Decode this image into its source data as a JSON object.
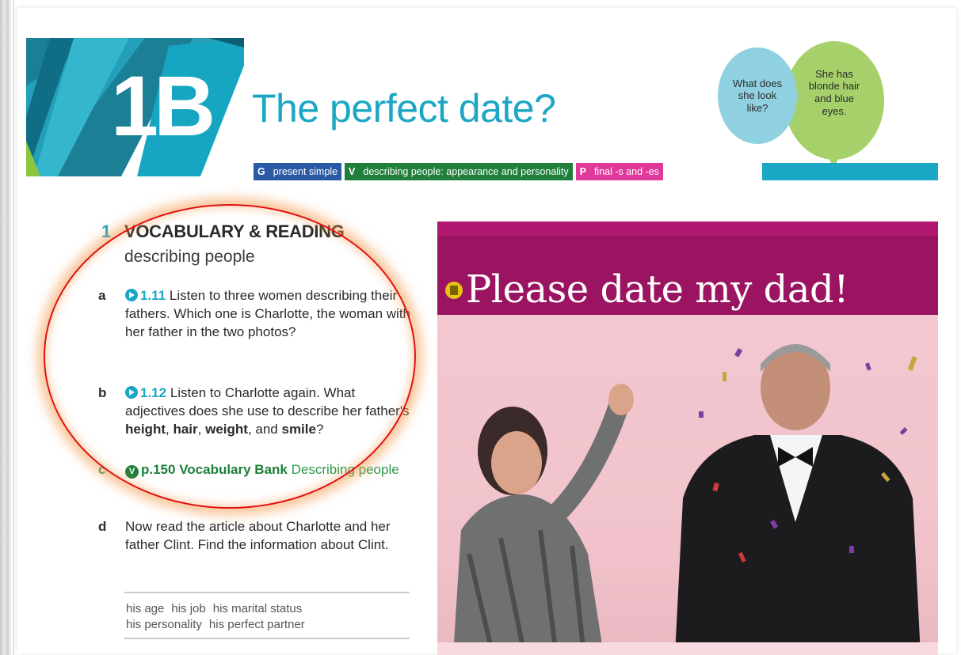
{
  "header": {
    "lesson_code": "1B",
    "lesson_title": "The perfect date?",
    "bubbles": {
      "question": "What does she look like?",
      "answer": "She has blonde hair and blue eyes."
    },
    "tags": [
      {
        "key": "G",
        "label": "present simple"
      },
      {
        "key": "V",
        "label": "describing people: appearance and personality"
      },
      {
        "key": "P",
        "label": "final -s and -es"
      }
    ]
  },
  "section": {
    "number": "1",
    "title": "VOCABULARY & READING",
    "subtitle": "describing people"
  },
  "exercises": {
    "a": {
      "letter": "a",
      "ref": "1.11",
      "text": "Listen to three women describing their fathers. Which one is Charlotte, the woman with her father in the two photos?"
    },
    "b": {
      "letter": "b",
      "ref": "1.12",
      "text_start": "Listen to Charlotte again. What adjectives does she use to describe her father's ",
      "w1": "height",
      "sep1": ", ",
      "w2": "hair",
      "sep2": ", ",
      "w3": "weight",
      "sep3": ", and ",
      "w4": "smile",
      "end": "?"
    },
    "c": {
      "letter": "c",
      "icon": "V",
      "bank": "p.150 Vocabulary Bank",
      "rest": "Describing people"
    },
    "d": {
      "letter": "d",
      "text": "Now read the article about Charlotte and her father Clint. Find the information about Clint."
    }
  },
  "wordbox": [
    "his age",
    "his job",
    "his marital status",
    "his personality",
    "his perfect partner"
  ],
  "article": {
    "title": "Please date my dad!"
  },
  "colors": {
    "teal": "#1ba7c4",
    "grammar": "#2a5aa5",
    "vocab": "#1f7f3b",
    "pron": "#e0399a",
    "article_band": "#9b1462",
    "highlight": "#e01010"
  }
}
